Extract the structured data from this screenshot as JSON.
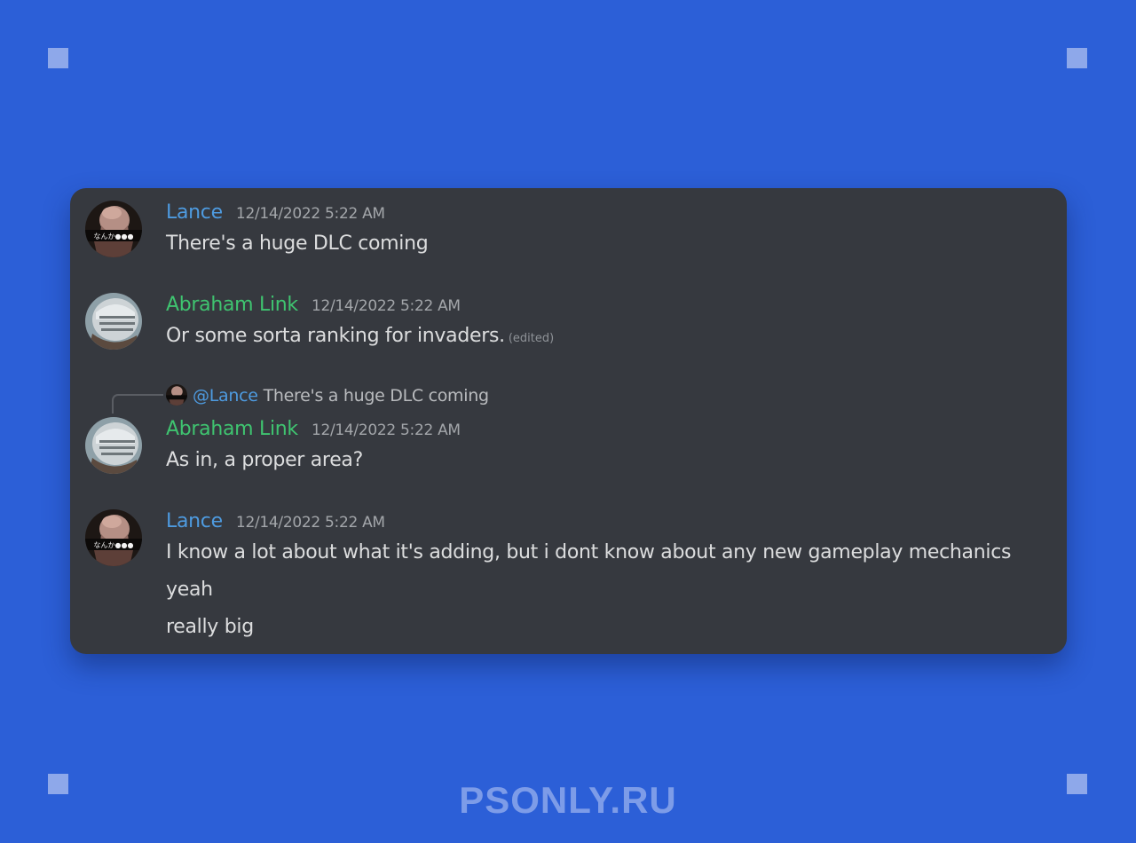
{
  "colors": {
    "page_background": "#2c5fd7",
    "card_background": "#36393f",
    "username_blue": "#4e9be0",
    "username_green": "#3fc470",
    "watermark": "#7d9ce8"
  },
  "messages": [
    {
      "author": "Lance",
      "author_color": "blue",
      "avatar": "anime-character-avatar",
      "timestamp": "12/14/2022 5:22 AM",
      "lines": [
        "There's a huge DLC coming"
      ]
    },
    {
      "author": "Abraham Link",
      "author_color": "green",
      "avatar": "knight-helmet-avatar",
      "timestamp": "12/14/2022 5:22 AM",
      "lines": [
        "Or some sorta ranking for invaders."
      ],
      "edited_label": "(edited)"
    },
    {
      "author": "Abraham Link",
      "author_color": "green",
      "avatar": "knight-helmet-avatar",
      "timestamp": "12/14/2022 5:22 AM",
      "reply": {
        "mention": "@Lance",
        "text": "There's a huge DLC coming"
      },
      "lines": [
        "As in, a proper area?"
      ]
    },
    {
      "author": "Lance",
      "author_color": "blue",
      "avatar": "anime-character-avatar",
      "timestamp": "12/14/2022 5:22 AM",
      "lines": [
        "I know a lot about what it's adding, but i dont know about any new gameplay mechanics",
        "yeah",
        "really big"
      ]
    }
  ],
  "watermark": "PSONLY.RU"
}
